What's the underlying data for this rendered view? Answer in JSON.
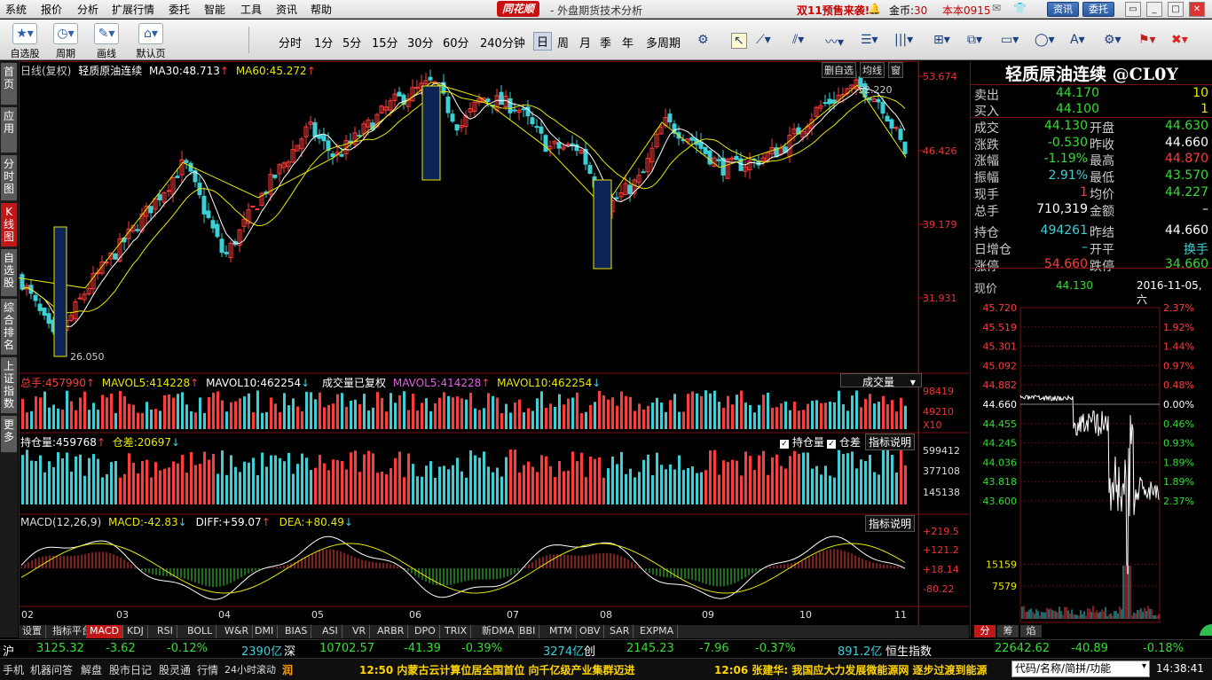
{
  "menubar": {
    "items": [
      "系统",
      "报价",
      "分析",
      "扩展行情",
      "委托",
      "智能",
      "工具",
      "资讯",
      "帮助"
    ],
    "brand": "同花顺",
    "subtitle": "- 外盘期货技术分析",
    "promo": "双11预售来袭!",
    "gold_label": "金币:",
    "gold_value": "30",
    "account": "本本0915",
    "btn_news": "资讯",
    "btn_trade": "委托"
  },
  "toolbar": {
    "tools": [
      {
        "label": "自选股",
        "icon": "star-icon"
      },
      {
        "label": "周期",
        "icon": "clock-icon"
      },
      {
        "label": "画线",
        "icon": "pen-icon"
      },
      {
        "label": "默认页",
        "icon": "home-icon"
      }
    ],
    "periods": [
      "分时",
      "1分",
      "5分",
      "15分",
      "30分",
      "60分",
      "240分钟",
      "日",
      "周",
      "月",
      "季",
      "年",
      "多周期"
    ],
    "active_period": "日"
  },
  "sidebar": {
    "tabs": [
      "首页",
      "应用",
      "分时图",
      "K线图",
      "自选股",
      "综合排名",
      "上证指数",
      "更多"
    ],
    "active": "K线图"
  },
  "chart": {
    "title": "日线(复权)",
    "symbol": "轻质原油连续",
    "ma30_label": "MA30:",
    "ma30": "48.713",
    "ma60_label": "MA60:",
    "ma60": "45.272",
    "btn_remove_fav": "删自选",
    "btn_avgline": "均线",
    "btn_window": "窗",
    "price_axis": [
      "53.674",
      "46.426",
      "39.179",
      "31.931"
    ],
    "price_range": [
      23.5,
      54.6
    ],
    "annotations": {
      "high": "52.220",
      "low": "26.050"
    },
    "volume": {
      "label": "总手:",
      "value": "457990",
      "mavol5_label": "MAVOL5:",
      "mavol5": "414228",
      "mavol10_label": "MAVOL10:",
      "mavol10": "462254",
      "note": "成交量已复权",
      "mavol5b": "414228",
      "mavol10b": "462254",
      "dropdown": "成交量",
      "axis": [
        "98419",
        "49210"
      ],
      "unit": "X10"
    },
    "oi": {
      "label": "持仓量:",
      "value": "459768",
      "diff_label": "仓差:",
      "diff": "20697",
      "check_oi": "持仓量",
      "check_diff": "仓差",
      "btn_help": "指标说明",
      "axis": [
        "599412",
        "377108",
        "145138"
      ]
    },
    "macd": {
      "label": "MACD(12,26,9)",
      "macd_label": "MACD:",
      "macd": "-42.83",
      "diff_label": "DIFF:",
      "diff": "+59.07",
      "dea_label": "DEA:",
      "dea": "+80.49",
      "btn_help": "指标说明",
      "axis": [
        "+219.5",
        "+121.2",
        "+18.14",
        "-80.22"
      ]
    },
    "months": [
      "02",
      "03",
      "04",
      "05",
      "06",
      "07",
      "08",
      "09",
      "10",
      "11"
    ]
  },
  "indicator_tabs": [
    "设置",
    "指标平台",
    "MACD",
    "KDJ",
    "RSI",
    "BOLL",
    "W&R",
    "DMI",
    "BIAS",
    "ASI",
    "VR",
    "ARBR",
    "DPO",
    "TRIX",
    "新DMA",
    "BBI",
    "MTM",
    "OBV",
    "SAR",
    "EXPMA"
  ],
  "active_indicator": "MACD",
  "quote": {
    "title": "轻质原油连续 @CL0Y",
    "ask_label": "卖出",
    "ask": "44.170",
    "ask_vol": "10",
    "bid_label": "买入",
    "bid": "44.100",
    "bid_vol": "1",
    "rows": [
      {
        "l1": "成交",
        "v1": "44.130",
        "c1": "green",
        "l2": "开盘",
        "v2": "44.630",
        "c2": "green"
      },
      {
        "l1": "涨跌",
        "v1": "-0.530",
        "c1": "green",
        "l2": "昨收",
        "v2": "44.660",
        "c2": "white"
      },
      {
        "l1": "涨幅",
        "v1": "-1.19%",
        "c1": "green",
        "l2": "最高",
        "v2": "44.870",
        "c2": "red"
      },
      {
        "l1": "振幅",
        "v1": "2.91%",
        "c1": "cyan",
        "l2": "最低",
        "v2": "43.570",
        "c2": "green"
      },
      {
        "l1": "现手",
        "v1": "1",
        "c1": "red",
        "l2": "均价",
        "v2": "44.227",
        "c2": "green"
      },
      {
        "l1": "总手",
        "v1": "710,319",
        "c1": "white",
        "l2": "金额",
        "v2": "–",
        "c2": "white"
      },
      {
        "l1": "持仓",
        "v1": "494261",
        "c1": "cyan",
        "l2": "昨结",
        "v2": "44.660",
        "c2": "white"
      },
      {
        "l1": "日增仓",
        "v1": "–",
        "c1": "cyan",
        "l2": "开平",
        "v2": "换手",
        "c2": "cyan"
      },
      {
        "l1": "涨停",
        "v1": "54.660",
        "c1": "red",
        "l2": "跌停",
        "v2": "34.660",
        "c2": "green"
      }
    ],
    "now_label": "现价",
    "now_value": "44.130",
    "now_date": "2016-11-05,六",
    "mini_left": [
      "45.720",
      "45.519",
      "45.301",
      "45.092",
      "44.882",
      "44.660",
      "44.455",
      "44.245",
      "44.036",
      "43.818",
      "43.600",
      "15159",
      "7579"
    ],
    "mini_right": [
      "2.37%",
      "1.92%",
      "1.44%",
      "0.97%",
      "0.48%",
      "0.00%",
      "0.46%",
      "0.93%",
      "1.89%",
      "1.89%",
      "2.37%"
    ],
    "mini_tabs": [
      "分",
      "筹",
      "焰"
    ],
    "active_mini_tab": "分"
  },
  "ticker": {
    "sh_label": "沪",
    "sh_value": "3125.32",
    "sh_chg": "-3.62",
    "sh_pct": "-0.12%",
    "sh_amt": "2390亿",
    "sz_label": "深",
    "sz_value": "10702.57",
    "sz_chg": "-41.39",
    "sz_pct": "-0.39%",
    "sz_amt": "3274亿",
    "cy_label": "创",
    "cy_value": "2145.23",
    "cy_chg": "-7.96",
    "cy_pct": "-0.37%",
    "cy_amt": "891.2亿",
    "hs_label": "恒生指数",
    "hs_value": "22642.62",
    "hs_chg": "-40.89",
    "hs_pct": "-0.18%"
  },
  "status": {
    "items": [
      "手机",
      "机器问答",
      "解盘",
      "股市日记",
      "股灵通",
      "行情",
      "24小时滚动"
    ],
    "news1": "12:50 内蒙古云计算位居全国首位 向千亿级产业集群迈进",
    "news2": "12:06 张建华: 我国应大力发展微能源网 逐步过渡到能源",
    "search_placeholder": "代码/名称/简拼/功能",
    "time": "14:38:41"
  }
}
